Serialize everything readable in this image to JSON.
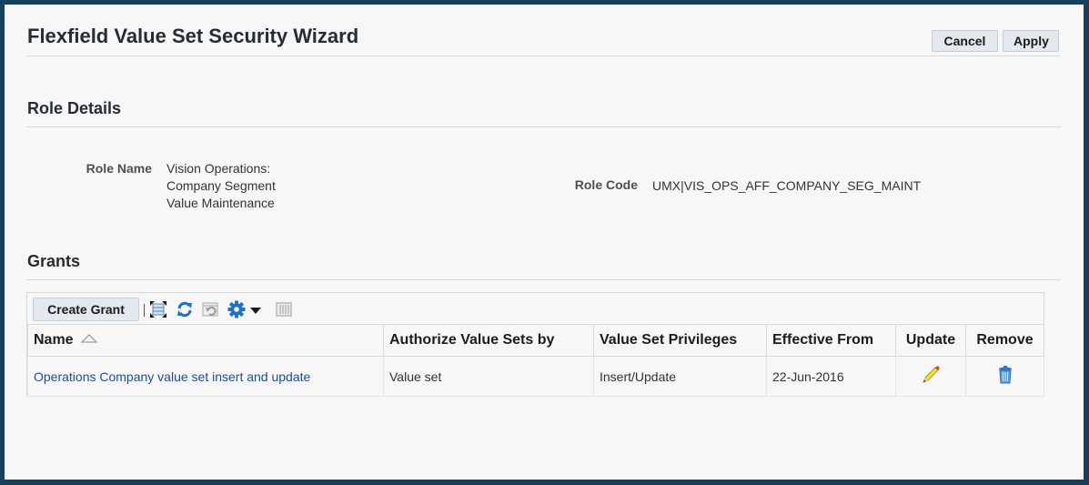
{
  "header": {
    "title": "Flexfield Value Set Security Wizard",
    "cancel_label": "Cancel",
    "apply_label": "Apply"
  },
  "role_details": {
    "section_title": "Role Details",
    "role_name_label": "Role Name",
    "role_name_lines": [
      "Vision Operations:",
      "Company Segment",
      "Value Maintenance"
    ],
    "role_code_label": "Role Code",
    "role_code_value": "UMX|VIS_OPS_AFF_COMPANY_SEG_MAINT"
  },
  "grants": {
    "section_title": "Grants",
    "toolbar": {
      "create_label": "Create Grant",
      "icons": [
        "detach-icon",
        "refresh-icon",
        "revert-icon",
        "gear-icon",
        "caret-down-icon",
        "freeze-columns-icon"
      ]
    },
    "columns": [
      "Name",
      "Authorize Value Sets by",
      "Value Set Privileges",
      "Effective From",
      "Update",
      "Remove"
    ],
    "sort": {
      "column": "Name",
      "direction": "ascending"
    },
    "rows": [
      {
        "name": "Operations Company value set insert and update",
        "authorize_by": "Value set",
        "privileges": "Insert/Update",
        "effective_from": "22-Jun-2016",
        "update_icon": "pencil-icon",
        "remove_icon": "trash-icon"
      }
    ]
  },
  "colors": {
    "frame": "#17405f",
    "background": "#f7f7f7",
    "link": "#1f4d8c",
    "button_bg": "#e4e8ef",
    "icon_blue": "#1d72c4"
  }
}
